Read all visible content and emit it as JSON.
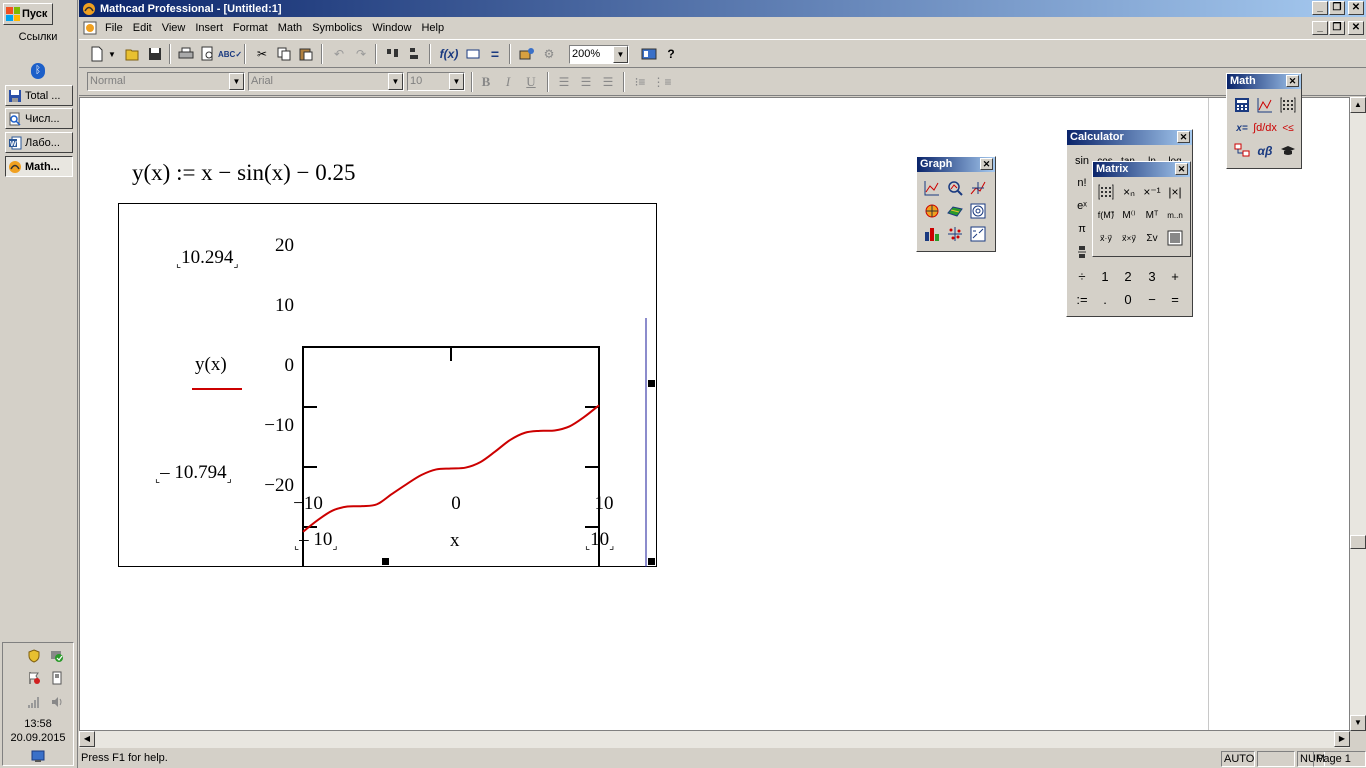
{
  "taskbar": {
    "start_label": "Пуск",
    "links_label": "Ссылки",
    "buttons": [
      {
        "label": "Total ...",
        "icon": "floppy-icon"
      },
      {
        "label": "Числ...",
        "icon": "search-doc-icon"
      },
      {
        "label": "Лабо...",
        "icon": "word-icon"
      },
      {
        "label": "Math...",
        "icon": "mathcad-icon"
      }
    ],
    "clock": "13:58",
    "date": "20.09.2015"
  },
  "window": {
    "title": "Mathcad Professional - [Untitled:1]",
    "caption_buttons": [
      "_",
      "❐",
      "✕"
    ]
  },
  "menu": [
    "File",
    "Edit",
    "View",
    "Insert",
    "Format",
    "Math",
    "Symbolics",
    "Window",
    "Help"
  ],
  "toolbar": {
    "zoom": "200%"
  },
  "format_bar": {
    "style": "Normal",
    "font": "Arial",
    "size": "10",
    "bold": "B",
    "italic": "I",
    "underline": "U"
  },
  "document": {
    "definition": "y(x) := x − sin(x) − 0.25",
    "plot": {
      "legend": "y(x)",
      "xvar": "x",
      "y_upper_limit": "10.294",
      "y_lower_limit": "– 10.794",
      "x_lower_limit": "– 10",
      "x_upper_limit": "10",
      "y_ticks": [
        "20",
        "10",
        "0",
        "−10",
        "−20"
      ],
      "x_ticks": [
        "−10",
        "0",
        "10"
      ]
    }
  },
  "chart_data": {
    "type": "line",
    "xlabel": "x",
    "ylabel": "y(x)",
    "xlim": [
      -10,
      10
    ],
    "ylim": [
      -20,
      20
    ],
    "series": [
      {
        "name": "y(x)",
        "color": "#cc0000",
        "x": [
          -10,
          -9,
          -8,
          -7,
          -6,
          -5,
          -4,
          -3,
          -2,
          -1,
          0,
          1,
          2,
          3,
          4,
          5,
          6,
          7,
          8,
          9,
          10
        ],
        "y": [
          -10.79,
          -8.84,
          -7.26,
          -6.59,
          -6.53,
          -6.21,
          -4.51,
          -2.86,
          -1.34,
          -0.41,
          -0.25,
          -0.09,
          0.84,
          2.61,
          4.51,
          5.71,
          6.03,
          6.09,
          6.76,
          8.34,
          10.29
        ]
      }
    ]
  },
  "palettes": {
    "graph": {
      "title": "Graph"
    },
    "calculator": {
      "title": "Calculator",
      "rows": [
        [
          "sin",
          "cos",
          "tan",
          "ln",
          "log"
        ],
        [
          "n!",
          "",
          "",
          "",
          ""
        ],
        [
          "eˣ",
          "",
          "",
          "",
          ""
        ],
        [
          "π",
          "",
          "",
          "",
          ""
        ],
        [
          "",
          "",
          "",
          "",
          ""
        ],
        [
          "÷",
          "1",
          "2",
          "3",
          "+"
        ],
        [
          ":=",
          ".",
          "0",
          "−",
          "="
        ]
      ]
    },
    "matrix": {
      "title": "Matrix"
    },
    "math": {
      "title": "Math"
    }
  },
  "status": {
    "help": "Press F1 for help.",
    "auto": "AUTO",
    "num": "NUM",
    "page": "Page 1"
  }
}
